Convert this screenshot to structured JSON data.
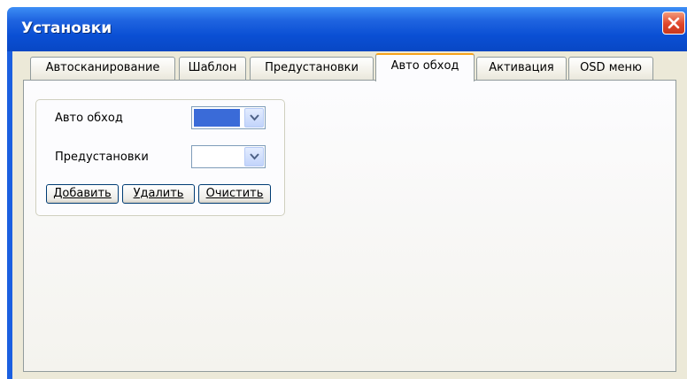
{
  "window": {
    "title": "Установки",
    "close_icon": "close-icon"
  },
  "tabs": [
    {
      "label": "Автосканирование",
      "active": false
    },
    {
      "label": "Шаблон",
      "active": false
    },
    {
      "label": "Предустановки",
      "active": false
    },
    {
      "label": "Авто обход",
      "active": true
    },
    {
      "label": "Активация",
      "active": false
    },
    {
      "label": "OSD меню",
      "active": false
    }
  ],
  "form": {
    "auto_tour_label": "Авто обход",
    "auto_tour_selected_color": "#3a6bd8",
    "presets_label": "Предустановки",
    "presets_value": ""
  },
  "buttons": {
    "add": "Добавить",
    "delete": "Удалить",
    "clear": "Очистить"
  },
  "colors": {
    "titlebar": "#0a4fd4",
    "active_tab_accent": "#f6a21a",
    "client_bg": "#ece9d8"
  }
}
